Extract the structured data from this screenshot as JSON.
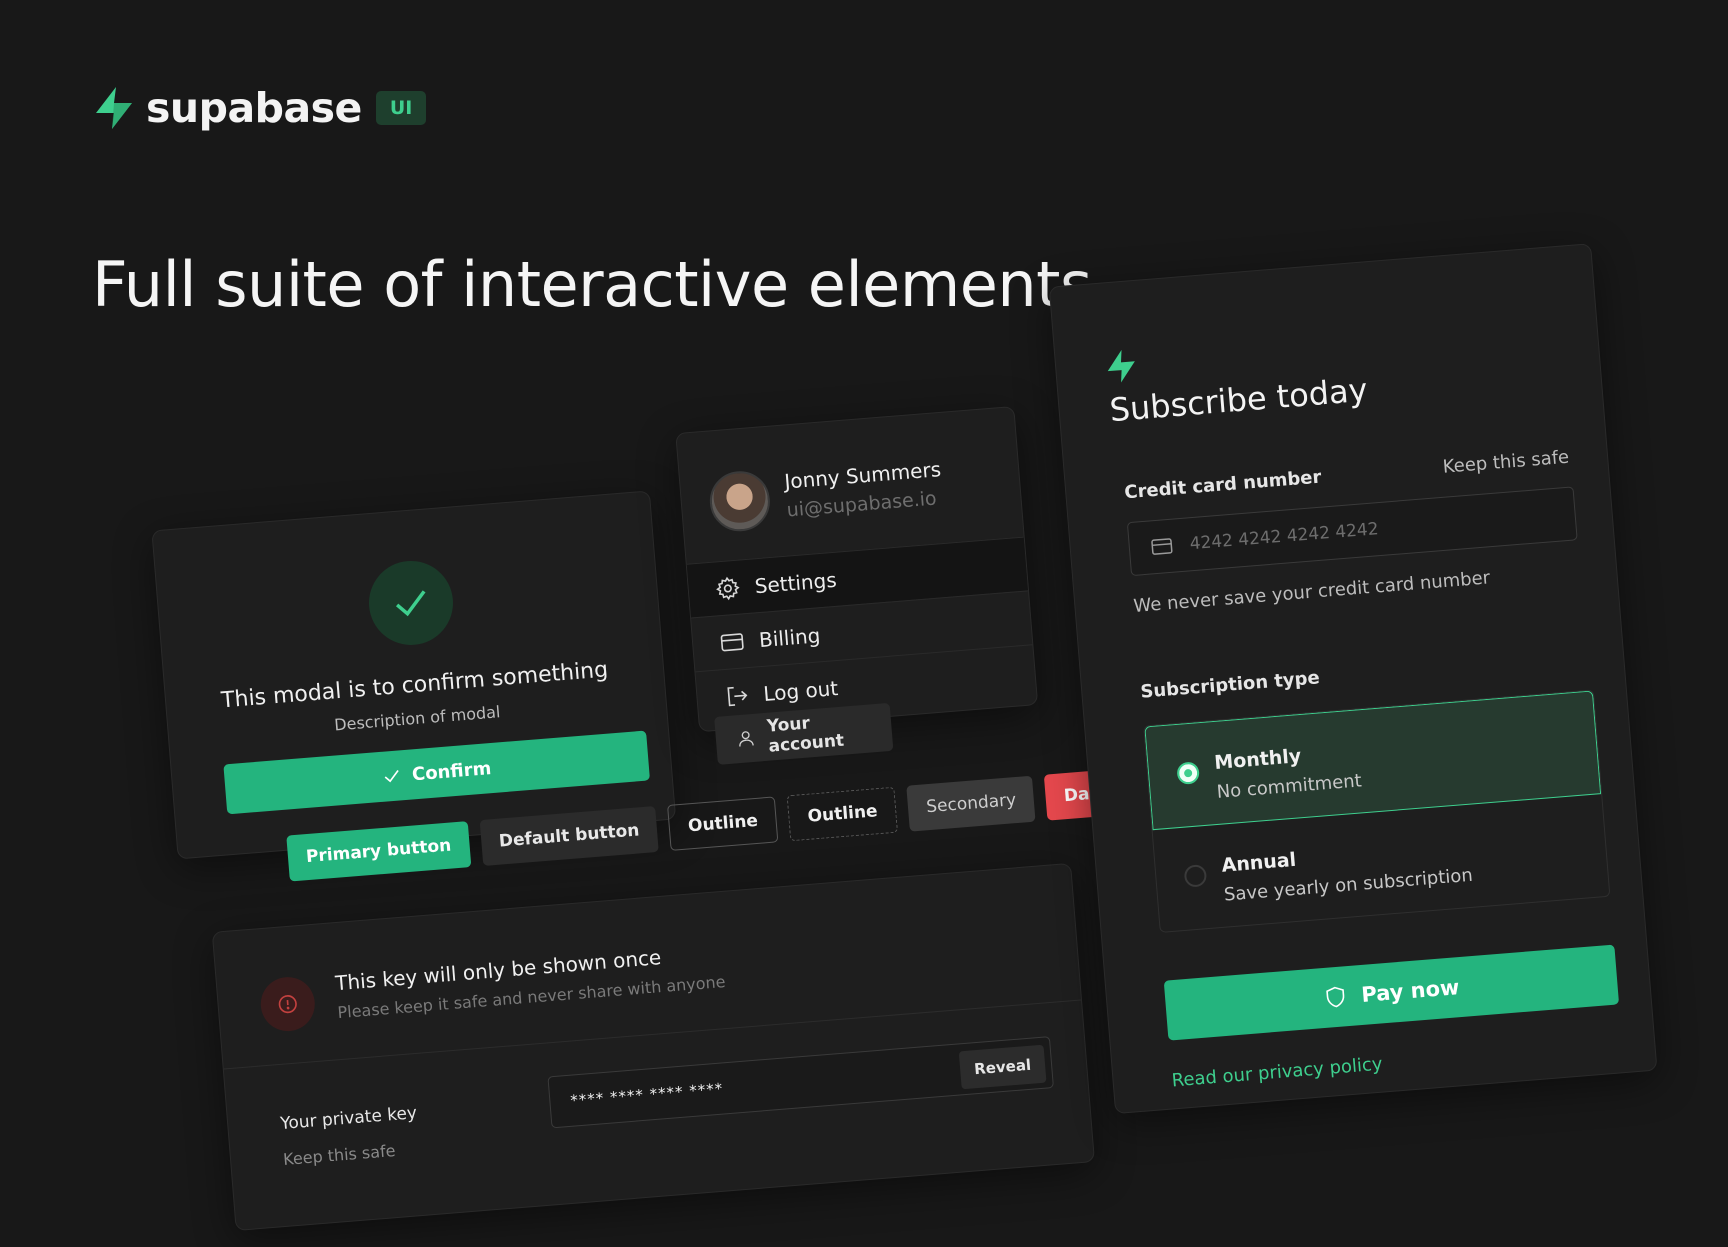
{
  "brand": {
    "name": "supabase",
    "badge": "UI",
    "accent": "#3ecf8e",
    "button_green": "#24b47e",
    "danger": "#e5484d",
    "background": "#181818"
  },
  "headline": "Full suite of interactive elements",
  "modal": {
    "icon": "check-icon",
    "title": "This modal is to confirm something",
    "description": "Description of modal",
    "confirm_label": "Confirm"
  },
  "profile_menu": {
    "user_name": "Jonny Summers",
    "user_email": "ui@supabase.io",
    "items": [
      {
        "label": "Settings",
        "icon": "gear-icon"
      },
      {
        "label": "Billing",
        "icon": "credit-card-icon"
      },
      {
        "label": "Log out",
        "icon": "logout-icon"
      }
    ],
    "account_button": "Your account"
  },
  "buttons": {
    "primary": "Primary button",
    "default": "Default button",
    "outline": "Outline",
    "outline_dashed": "Outline",
    "secondary": "Secondary",
    "danger": "Danger"
  },
  "key_card": {
    "title": "This key will only be shown once",
    "description": "Please keep it safe and never share with anyone",
    "field_label": "Your private key",
    "field_help": "Keep this safe",
    "field_value": "**** **** **** ****",
    "reveal_label": "Reveal"
  },
  "subscribe": {
    "title": "Subscribe today",
    "cc_label": "Credit card number",
    "cc_hint": "Keep this safe",
    "cc_placeholder": "4242 4242 4242 4242",
    "cc_help": "We never save your credit card number",
    "subscription_label": "Subscription type",
    "options": [
      {
        "title": "Monthly",
        "description": "No commitment",
        "selected": true
      },
      {
        "title": "Annual",
        "description": "Save yearly on subscription",
        "selected": false
      }
    ],
    "pay_label": "Pay now",
    "privacy_link": "Read our privacy policy"
  }
}
